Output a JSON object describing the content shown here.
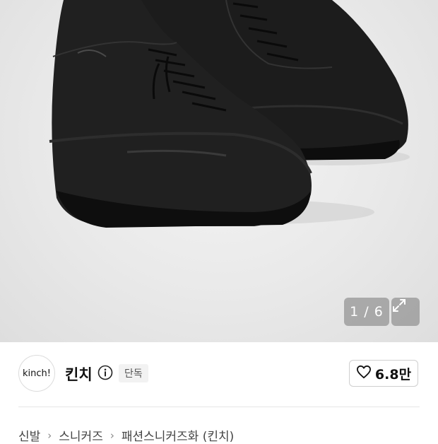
{
  "gallery": {
    "counter": "1 / 6",
    "expand_icon": "expand-arrows-icon"
  },
  "brand": {
    "logo_text": "kinch!",
    "name": "킨치",
    "badge": "단독",
    "info_icon": "info-icon"
  },
  "like": {
    "icon": "heart-outline-icon",
    "count": "6.8만"
  },
  "breadcrumb": {
    "items": [
      "신발",
      "스니커즈",
      "패션스니커즈화 (킨치)"
    ],
    "separator_icon": "chevron-right-icon"
  }
}
